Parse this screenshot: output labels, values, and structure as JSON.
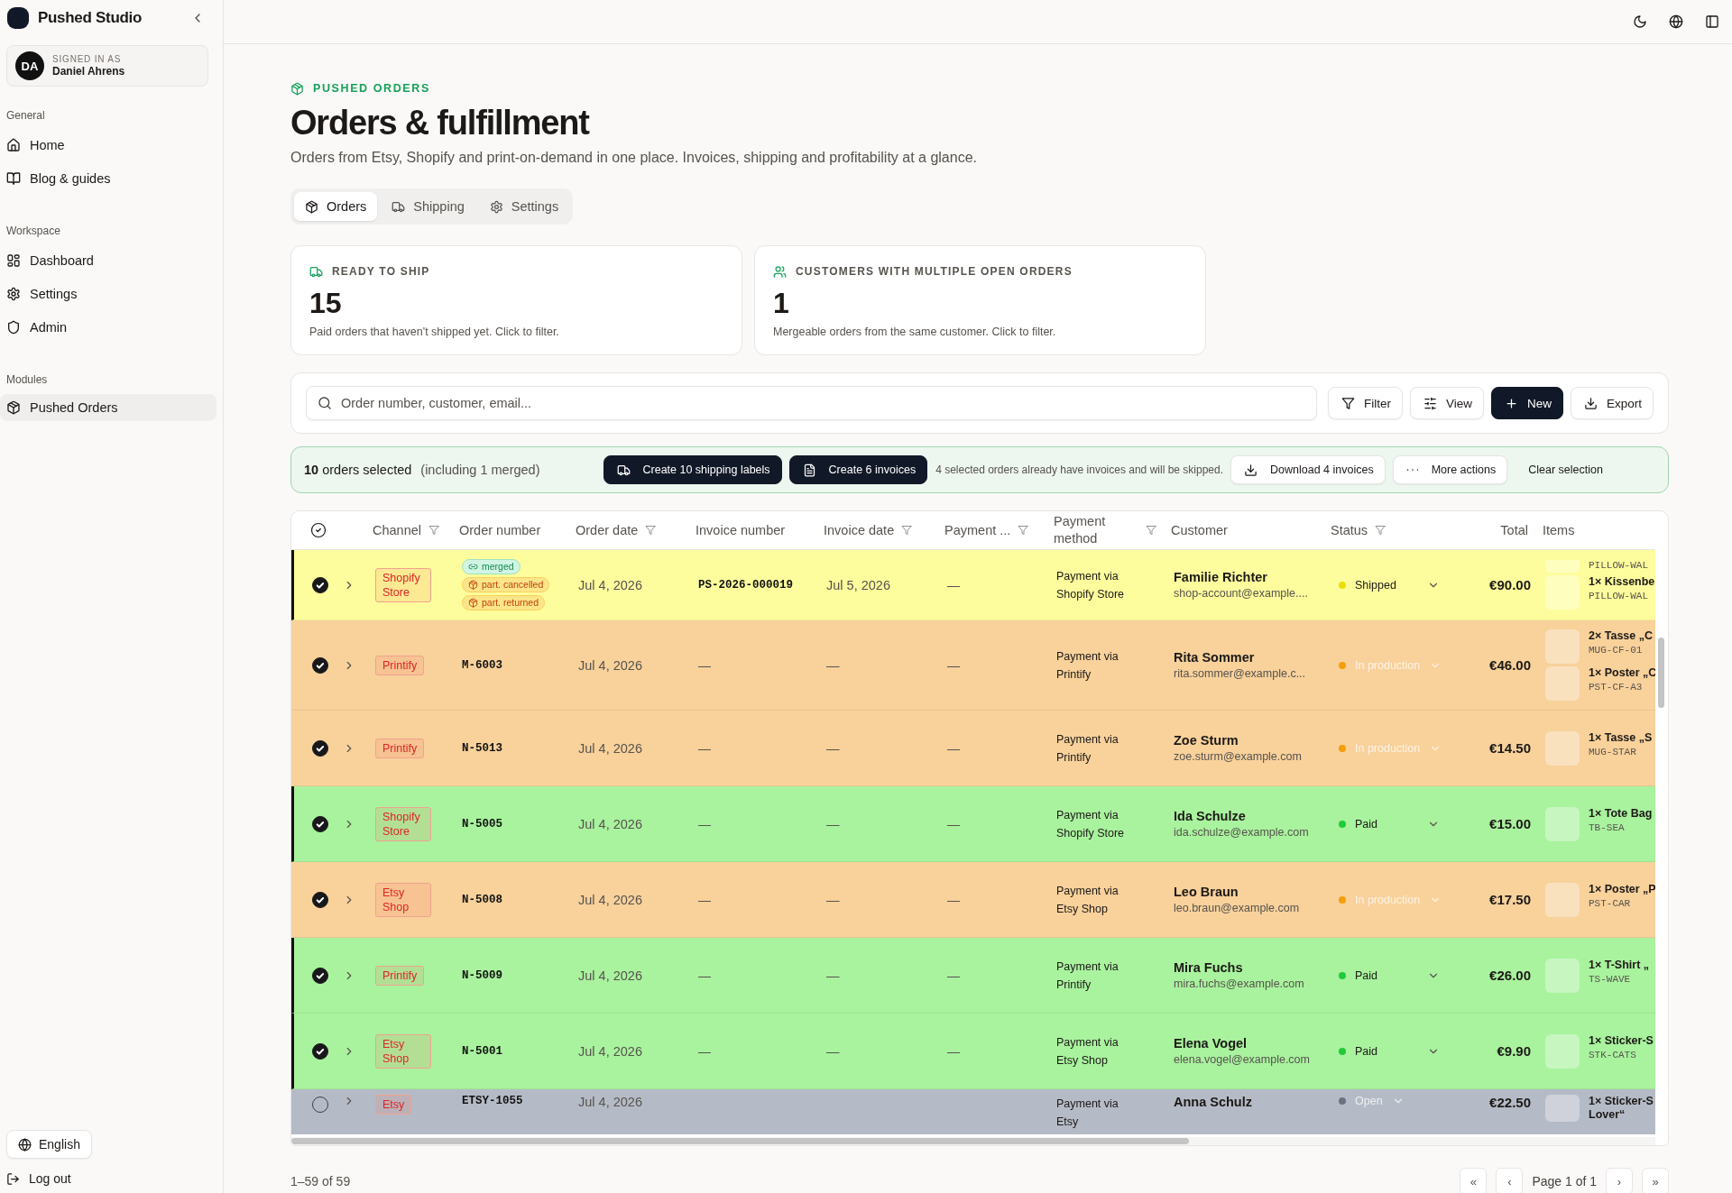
{
  "sidebar": {
    "brand": "Pushed Studio",
    "user": {
      "initials": "DA",
      "caption": "SIGNED IN AS",
      "name": "Daniel Ahrens"
    },
    "sections": [
      {
        "title": "General",
        "items": [
          {
            "label": "Home",
            "selected": false
          },
          {
            "label": "Blog & guides",
            "selected": false
          }
        ]
      },
      {
        "title": "Workspace",
        "items": [
          {
            "label": "Dashboard",
            "selected": false
          },
          {
            "label": "Settings",
            "selected": false
          },
          {
            "label": "Admin",
            "selected": false
          }
        ]
      },
      {
        "title": "Modules",
        "items": [
          {
            "label": "Pushed Orders",
            "selected": true
          }
        ]
      }
    ],
    "language": "English",
    "logout": "Log out"
  },
  "header": {
    "eyebrow": "PUSHED ORDERS",
    "title": "Orders & fulfillment",
    "subtitle": "Orders from Etsy, Shopify and print-on-demand in one place. Invoices, shipping and profitability at a glance."
  },
  "tabs": [
    {
      "label": "Orders",
      "selected": true
    },
    {
      "label": "Shipping",
      "selected": false
    },
    {
      "label": "Settings",
      "selected": false
    }
  ],
  "stats": [
    {
      "caption": "READY TO SHIP",
      "value": "15",
      "note": "Paid orders that haven't shipped yet. Click to filter."
    },
    {
      "caption": "CUSTOMERS WITH MULTIPLE OPEN ORDERS",
      "value": "1",
      "note": "Mergeable orders from the same customer. Click to filter."
    }
  ],
  "toolbar": {
    "search": {
      "placeholder": "Order number, customer, email..."
    },
    "buttons": [
      {
        "label": "Filter",
        "kind": "outline"
      },
      {
        "label": "View",
        "kind": "outline"
      },
      {
        "label": "New",
        "kind": "primary"
      },
      {
        "label": "Export",
        "kind": "outline"
      }
    ]
  },
  "selection": {
    "summary": "**10** orders selected",
    "note": "(including 1 merged)",
    "actions": [
      {
        "label": "Create 10 shipping labels",
        "kind": "primary"
      },
      {
        "label": "Create 6 invoices",
        "kind": "primary"
      }
    ],
    "hint": "4 selected orders already have invoices and will be skipped.",
    "more_actions": [
      {
        "label": "Download 4 invoices",
        "kind": "outline"
      },
      {
        "label": "More actions",
        "kind": "outline"
      },
      {
        "label": "Clear selection",
        "kind": "ghost"
      }
    ]
  },
  "table": {
    "columns": [
      {
        "label": "Channel",
        "filter": true
      },
      {
        "label": "Order number",
        "filter": false
      },
      {
        "label": "Order date",
        "filter": true
      },
      {
        "label": "Invoice number",
        "filter": false
      },
      {
        "label": "Invoice date",
        "filter": true
      },
      {
        "label": "Payment ...",
        "filter": true
      },
      {
        "label": "Payment method",
        "filter": true
      },
      {
        "label": "Customer",
        "filter": false
      },
      {
        "label": "Status",
        "filter": true
      },
      {
        "label": "Total",
        "filter": false
      },
      {
        "label": "Items",
        "filter": false
      }
    ],
    "rows": [
      {
        "selected": true,
        "marked": true,
        "color": "#fefd9d",
        "channel": "Shopify Store",
        "badges": [
          {
            "kind": "merged",
            "label": "merged"
          },
          {
            "kind": "warning",
            "label": "part. cancelled"
          },
          {
            "kind": "warning",
            "label": "part. returned"
          }
        ],
        "order_date": "Jul 4, 2026",
        "invoice_number": "PS-2026-000019",
        "invoice_date": "Jul 5, 2026",
        "payment": "—",
        "payment_method": "Payment via Shopify Store",
        "customer": "Familie Richter",
        "email": "shop-account@example....",
        "status": {
          "label": "Shipped",
          "color": "#eae000",
          "muted": false
        },
        "total": "€90.00",
        "items": [
          {
            "sku": "PILLOW-WAL"
          },
          {
            "name": "1× Kissenbe",
            "sku": "PILLOW-WAL"
          }
        ]
      },
      {
        "selected": true,
        "marked": false,
        "color": "#f8d19b",
        "channel": "Printify",
        "order_number": "M-6003",
        "order_date": "Jul 4, 2026",
        "invoice_number": "—",
        "invoice_date": "—",
        "payment": "—",
        "payment_method": "Payment via Printify",
        "customer": "Rita Sommer",
        "email": "rita.sommer@example.c...",
        "status": {
          "label": "In production",
          "color": "#f59e0b",
          "muted": true
        },
        "total": "€46.00",
        "items": [
          {
            "name": "2× Tasse „C",
            "sku": "MUG-CF-01"
          },
          {
            "name": "1× Poster „C",
            "sku": "PST-CF-A3"
          }
        ]
      },
      {
        "selected": true,
        "marked": false,
        "color": "#f8d19b",
        "channel": "Printify",
        "order_number": "N-5013",
        "order_date": "Jul 4, 2026",
        "invoice_number": "—",
        "invoice_date": "—",
        "payment": "—",
        "payment_method": "Payment via Printify",
        "customer": "Zoe Sturm",
        "email": "zoe.sturm@example.com",
        "status": {
          "label": "In production",
          "color": "#f59e0b",
          "muted": true
        },
        "total": "€14.50",
        "items": [
          {
            "name": "1× Tasse „S",
            "sku": "MUG-STAR"
          }
        ]
      },
      {
        "selected": true,
        "marked": true,
        "color": "#a9f29e",
        "channel": "Shopify Store",
        "order_number": "N-5005",
        "order_date": "Jul 4, 2026",
        "invoice_number": "—",
        "invoice_date": "—",
        "payment": "—",
        "payment_method": "Payment via Shopify Store",
        "customer": "Ida Schulze",
        "email": "ida.schulze@example.com",
        "status": {
          "label": "Paid",
          "color": "#22c93a",
          "muted": false
        },
        "total": "€15.00",
        "items": [
          {
            "name": "1× Tote Bag",
            "sku": "TB-SEA"
          }
        ]
      },
      {
        "selected": true,
        "marked": false,
        "color": "#f8d19b",
        "channel": "Etsy Shop",
        "order_number": "N-5008",
        "order_date": "Jul 4, 2026",
        "invoice_number": "—",
        "invoice_date": "—",
        "payment": "—",
        "payment_method": "Payment via Etsy Shop",
        "customer": "Leo Braun",
        "email": "leo.braun@example.com",
        "status": {
          "label": "In production",
          "color": "#f59e0b",
          "muted": true
        },
        "total": "€17.50",
        "items": [
          {
            "name": "1× Poster „P",
            "sku": "PST-CAR"
          }
        ]
      },
      {
        "selected": true,
        "marked": true,
        "color": "#a9f29e",
        "channel": "Printify",
        "order_number": "N-5009",
        "order_date": "Jul 4, 2026",
        "invoice_number": "—",
        "invoice_date": "—",
        "payment": "—",
        "payment_method": "Payment via Printify",
        "customer": "Mira Fuchs",
        "email": "mira.fuchs@example.com",
        "status": {
          "label": "Paid",
          "color": "#22c93a",
          "muted": false
        },
        "total": "€26.00",
        "items": [
          {
            "name": "1× T-Shirt „",
            "sku": "TS-WAVE"
          }
        ]
      },
      {
        "selected": true,
        "marked": true,
        "color": "#a9f29e",
        "channel": "Etsy Shop",
        "order_number": "N-5001",
        "order_date": "Jul 4, 2026",
        "invoice_number": "—",
        "invoice_date": "—",
        "payment": "—",
        "payment_method": "Payment via Etsy Shop",
        "customer": "Elena Vogel",
        "email": "elena.vogel@example.com",
        "status": {
          "label": "Paid",
          "color": "#22c93a",
          "muted": false
        },
        "total": "€9.90",
        "items": [
          {
            "name": "1× Sticker-S",
            "sku": "STK-CATS"
          }
        ]
      },
      {
        "selected": false,
        "marked": false,
        "color": "#b5bbc6",
        "channel": "Etsy",
        "order_number": "ETSY-1055",
        "order_date": "Jul 4, 2026",
        "payment_method": "Payment via Etsy",
        "customer": "Anna Schulz",
        "status": {
          "label": "Open",
          "color": "#6b7280",
          "muted": true
        },
        "total": "€22.50",
        "items": [
          {
            "name": "1× Sticker-S Lover“"
          }
        ]
      }
    ]
  },
  "footer": {
    "range": "1–59 of 59",
    "pager": {
      "first": "«",
      "prev": "‹",
      "page": "Page 1 of 1",
      "next": "›",
      "last": "»"
    }
  }
}
